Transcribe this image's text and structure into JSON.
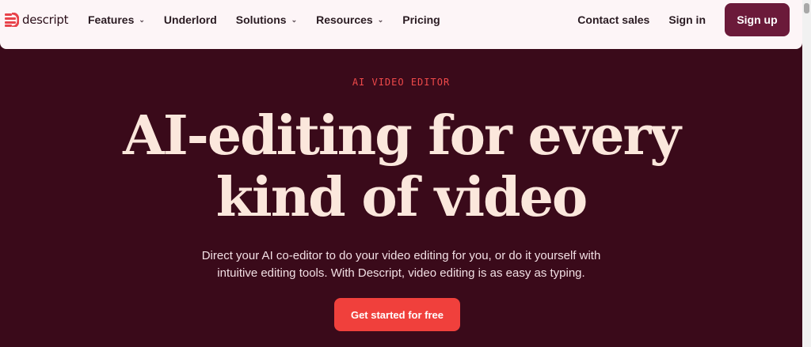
{
  "brand": {
    "name": "descript",
    "logo_icon": "descript-logo-icon",
    "accent": "#e8424a"
  },
  "nav": {
    "items": [
      {
        "label": "Features",
        "has_dropdown": true
      },
      {
        "label": "Underlord",
        "has_dropdown": false
      },
      {
        "label": "Solutions",
        "has_dropdown": true
      },
      {
        "label": "Resources",
        "has_dropdown": true
      },
      {
        "label": "Pricing",
        "has_dropdown": false
      }
    ],
    "dropdown_icon": "chevron-down-icon"
  },
  "header_actions": {
    "contact_sales": "Contact sales",
    "sign_in": "Sign in",
    "sign_up": "Sign up"
  },
  "hero": {
    "eyebrow": "AI VIDEO EDITOR",
    "headline_line1": "AI-editing for every",
    "headline_line2": "kind of video",
    "sub_line1": "Direct your AI co-editor to do your video editing for you, or do it yourself with",
    "sub_line2": "intuitive editing tools. With Descript, video editing is as easy as typing.",
    "cta": "Get started for free"
  },
  "colors": {
    "hero_bg": "#3a0a1a",
    "header_bg": "#fdf5f7",
    "signup_bg": "#6b1a3a",
    "cta_bg": "#f0403c",
    "headline": "#fbe7dc",
    "eyebrow": "#f04a4a"
  }
}
